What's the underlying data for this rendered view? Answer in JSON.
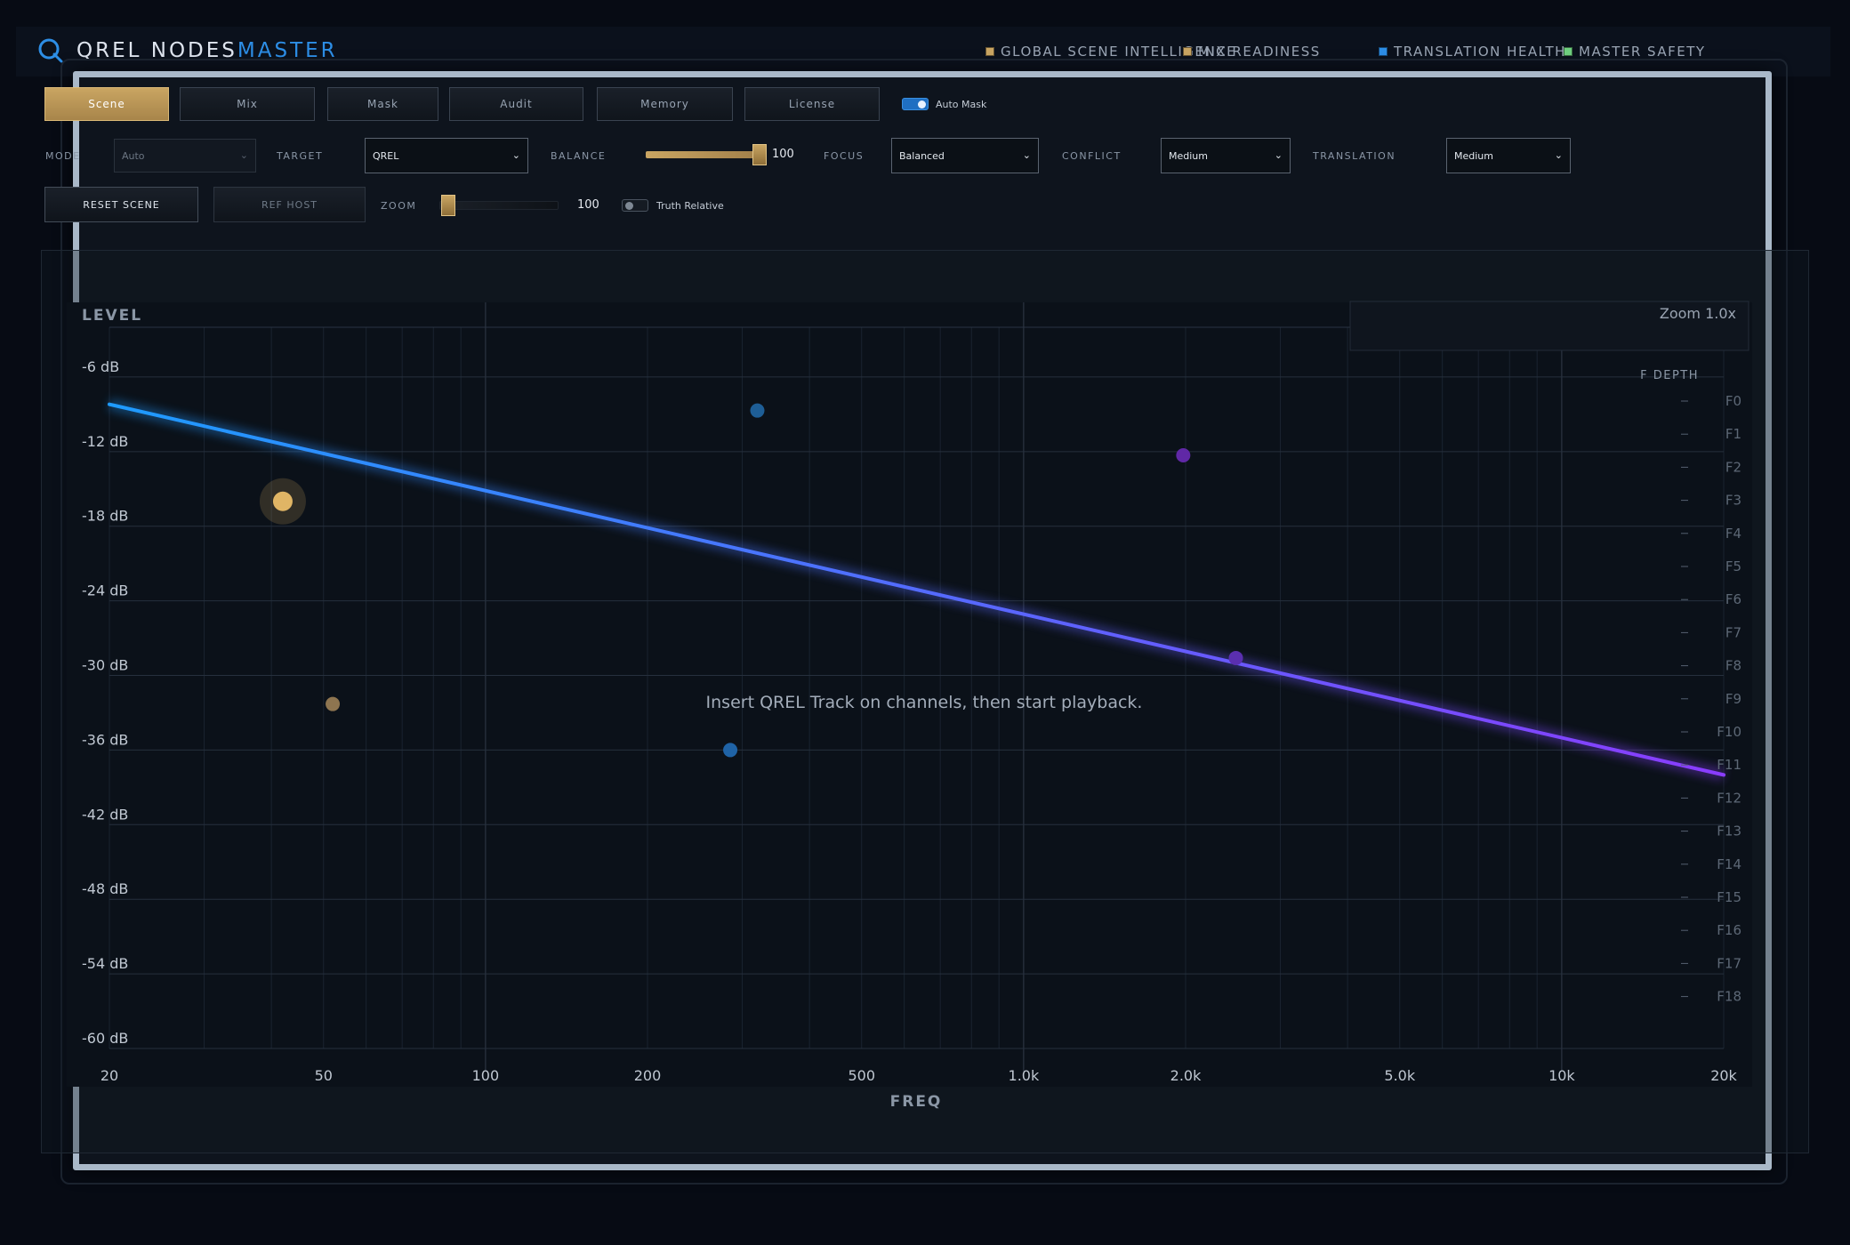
{
  "header": {
    "brand_main": "QREL NODES",
    "brand_accent": "MASTER",
    "status_items": [
      {
        "label": "GLOBAL SCENE INTELLIGENCE",
        "color": "#c9a562"
      },
      {
        "label": "MIX READINESS",
        "color": "#c9a562"
      },
      {
        "label": "TRANSLATION HEALTH",
        "color": "#2d8ee6"
      },
      {
        "label": "MASTER SAFETY",
        "color": "#6fcf7f"
      }
    ]
  },
  "tabs": [
    {
      "label": "Scene",
      "active": true
    },
    {
      "label": "Mix",
      "active": false
    },
    {
      "label": "Mask",
      "active": false
    },
    {
      "label": "Audit",
      "active": false
    },
    {
      "label": "Memory",
      "active": false
    },
    {
      "label": "License",
      "active": false
    }
  ],
  "auto_mask": {
    "label": "Auto Mask",
    "on": true
  },
  "controls": {
    "mode": {
      "label": "MODE",
      "value": "Auto"
    },
    "target": {
      "label": "TARGET",
      "value": "QREL"
    },
    "balance": {
      "label": "BALANCE",
      "value": "100",
      "fraction": 1.0
    },
    "focus": {
      "label": "FOCUS",
      "value": "Balanced"
    },
    "conflict": {
      "label": "CONFLICT",
      "value": "Medium"
    },
    "translation": {
      "label": "TRANSLATION",
      "value": "Medium"
    }
  },
  "row3": {
    "reset_label": "RESET SCENE",
    "ref_host_label": "REF HOST",
    "zoom_label": "ZOOM",
    "zoom_value": "100",
    "zoom_fraction": 0.0,
    "truth_relative": {
      "label": "Truth Relative",
      "on": false
    }
  },
  "chart_data": {
    "type": "scatter",
    "title": "",
    "ylabel": "LEVEL",
    "xlabel": "FREQ",
    "zoom_label": "Zoom 1.0x",
    "right_axis_label": "F DEPTH",
    "empty_message": "Insert QREL Track on channels, then start playback.",
    "x_scale": "log",
    "xlim": [
      20,
      20000
    ],
    "ylim": [
      -60,
      -2
    ],
    "x_ticks": [
      {
        "value": 20,
        "label": "20"
      },
      {
        "value": 50,
        "label": "50"
      },
      {
        "value": 100,
        "label": "100"
      },
      {
        "value": 200,
        "label": "200"
      },
      {
        "value": 500,
        "label": "500"
      },
      {
        "value": 1000,
        "label": "1.0k"
      },
      {
        "value": 2000,
        "label": "2.0k"
      },
      {
        "value": 5000,
        "label": "5.0k"
      },
      {
        "value": 10000,
        "label": "10k"
      },
      {
        "value": 20000,
        "label": "20k"
      }
    ],
    "y_ticks": [
      {
        "value": -6,
        "label": "-6 dB"
      },
      {
        "value": -12,
        "label": "-12 dB"
      },
      {
        "value": -18,
        "label": "-18 dB"
      },
      {
        "value": -24,
        "label": "-24 dB"
      },
      {
        "value": -30,
        "label": "-30 dB"
      },
      {
        "value": -36,
        "label": "-36 dB"
      },
      {
        "value": -42,
        "label": "-42 dB"
      },
      {
        "value": -48,
        "label": "-48 dB"
      },
      {
        "value": -54,
        "label": "-54 dB"
      },
      {
        "value": -60,
        "label": "-60 dB"
      }
    ],
    "depth_labels": [
      "F0",
      "F1",
      "F2",
      "F3",
      "F4",
      "F5",
      "F6",
      "F7",
      "F8",
      "F9",
      "F10",
      "F11",
      "F12",
      "F13",
      "F14",
      "F15",
      "F16",
      "F17",
      "F18"
    ],
    "trend_line": {
      "x": [
        20,
        20000
      ],
      "y": [
        -8.2,
        -38.0
      ],
      "color_start": "#1e9bff",
      "color_end": "#8a3cff"
    },
    "points": [
      {
        "x": 42,
        "y": -16.0,
        "color": "#e0b565",
        "highlight": true
      },
      {
        "x": 52,
        "y": -32.3,
        "color": "#8e7550"
      },
      {
        "x": 320,
        "y": -8.7,
        "color": "#1e5e96"
      },
      {
        "x": 285,
        "y": -36.0,
        "color": "#1f63a6"
      },
      {
        "x": 1980,
        "y": -12.3,
        "color": "#6028a6"
      },
      {
        "x": 2480,
        "y": -28.6,
        "color": "#5a2fb0"
      }
    ],
    "grid": true
  }
}
